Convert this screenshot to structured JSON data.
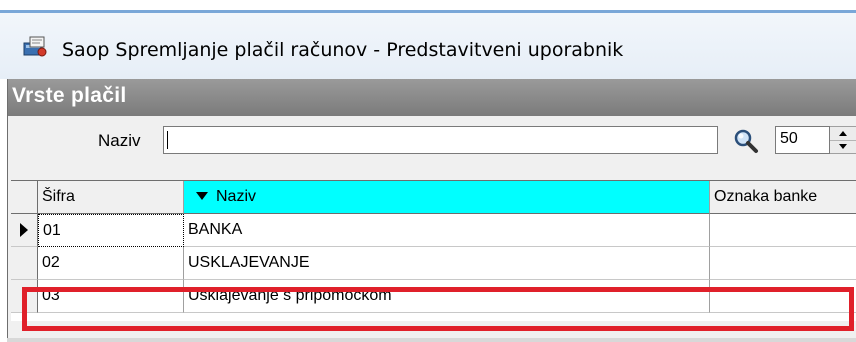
{
  "window": {
    "title": "Saop Spremljanje plačil računov - Predstavitveni uporabnik"
  },
  "panel": {
    "header": "Vrste plačil"
  },
  "filter": {
    "label": "Naziv",
    "value": "",
    "page_size": "50"
  },
  "grid": {
    "columns": [
      "Šifra",
      "Naziv",
      "Oznaka banke"
    ],
    "sorted_column": "Naziv",
    "rows": [
      {
        "sifra": "01",
        "naziv": "BANKA",
        "oznaka": "",
        "current": true
      },
      {
        "sifra": "02",
        "naziv": "USKLAJEVANJE",
        "oznaka": "",
        "current": false
      },
      {
        "sifra": "03",
        "naziv": "Usklajevanje s pripomočkom",
        "oznaka": "",
        "current": false
      }
    ]
  },
  "colors": {
    "sorted_header": "#00ffff",
    "highlight": "#e0202a",
    "panel_header": "#8a8a8a"
  },
  "icons": {
    "app": "app-payments-icon",
    "search": "magnifier-icon",
    "row_pointer": "current-row-arrow-icon",
    "sort": "sort-descending-icon"
  }
}
